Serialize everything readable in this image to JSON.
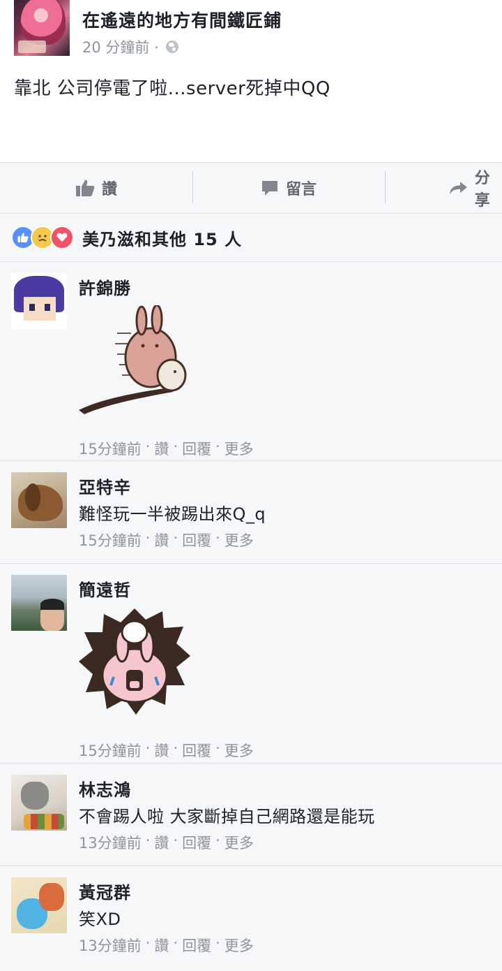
{
  "post": {
    "page_name": "在遙遠的地方有間鐵匠鋪",
    "time": "20 分鐘前 ·",
    "text": "靠北 公司停電了啦...server死掉中QQ"
  },
  "actions": {
    "like_label": "讚",
    "comment_label": "留言",
    "share_label": "分享"
  },
  "reactions": {
    "summary": "美乃滋和其他 15 人",
    "icons": [
      "like-icon",
      "sad-icon",
      "love-icon"
    ]
  },
  "comments": [
    {
      "name": "許錦勝",
      "text": "",
      "time": "15分鐘前",
      "sticker": "rabbit-running-sticker"
    },
    {
      "name": "亞特辛",
      "text": "難怪玩一半被踢出來Q_q",
      "time": "15分鐘前"
    },
    {
      "name": "簡遠哲",
      "text": "",
      "time": "15分鐘前",
      "sticker": "rabbit-screaming-sticker"
    },
    {
      "name": "林志鴻",
      "text": "不會踢人啦 大家斷掉自己網路還是能玩",
      "time": "13分鐘前"
    },
    {
      "name": "黃冠群",
      "text": "笑XD",
      "time": "13分鐘前"
    }
  ],
  "comment_actions": {
    "like": "讚",
    "reply": "回覆",
    "more": "更多",
    "separator": "·"
  },
  "colors": {
    "meta_gray": "#90949c",
    "like_blue": "#5890ff",
    "love_red": "#f25268"
  }
}
